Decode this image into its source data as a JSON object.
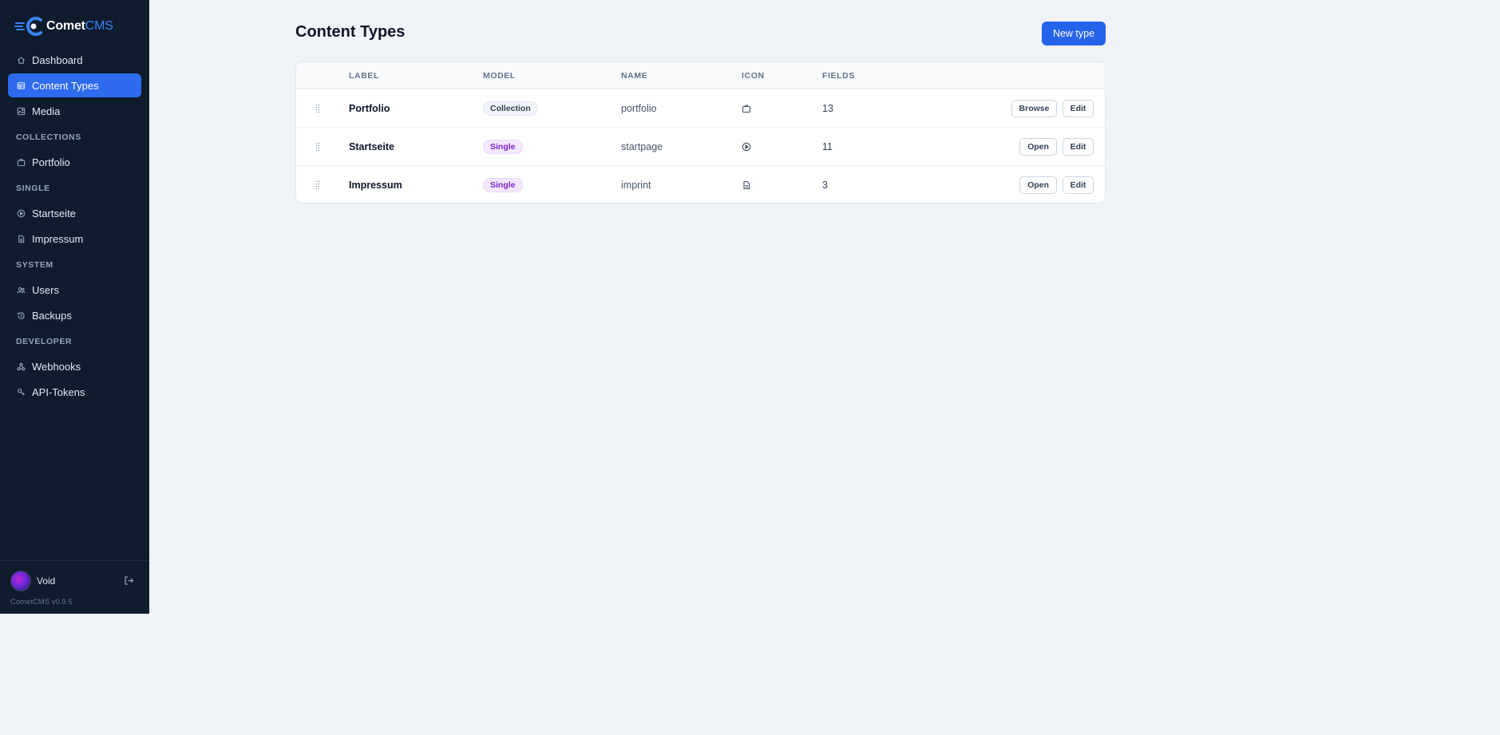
{
  "app": {
    "name_main": "Comet",
    "name_accent": "CMS",
    "version": "CometCMS v0.9.5"
  },
  "sidebar": {
    "items_top": [
      {
        "label": "Dashboard",
        "icon": "home-icon"
      },
      {
        "label": "Content Types",
        "icon": "table-icon",
        "active": true
      },
      {
        "label": "Media",
        "icon": "image-icon"
      }
    ],
    "section_collections": "COLLECTIONS",
    "items_collections": [
      {
        "label": "Portfolio",
        "icon": "briefcase-icon"
      }
    ],
    "section_single": "SINGLE",
    "items_single": [
      {
        "label": "Startseite",
        "icon": "play-circle-icon"
      },
      {
        "label": "Impressum",
        "icon": "document-icon"
      }
    ],
    "section_system": "SYSTEM",
    "items_system": [
      {
        "label": "Users",
        "icon": "users-icon"
      },
      {
        "label": "Backups",
        "icon": "history-icon"
      }
    ],
    "section_developer": "DEVELOPER",
    "items_developer": [
      {
        "label": "Webhooks",
        "icon": "webhook-icon"
      },
      {
        "label": "API-Tokens",
        "icon": "key-icon"
      }
    ],
    "user": {
      "name": "Void"
    }
  },
  "main": {
    "title": "Content Types",
    "new_button": "New type",
    "columns": {
      "label": "LABEL",
      "model": "MODEL",
      "name": "NAME",
      "icon": "ICON",
      "fields": "FIELDS"
    },
    "rows": [
      {
        "label": "Portfolio",
        "model": "Collection",
        "name": "portfolio",
        "icon": "briefcase-icon",
        "fields": "13",
        "action": "Browse",
        "edit": "Edit"
      },
      {
        "label": "Startseite",
        "model": "Single",
        "name": "startpage",
        "icon": "play-circle-icon",
        "fields": "11",
        "action": "Open",
        "edit": "Edit"
      },
      {
        "label": "Impressum",
        "model": "Single",
        "name": "imprint",
        "icon": "document-icon",
        "fields": "3",
        "action": "Open",
        "edit": "Edit"
      }
    ]
  },
  "colors": {
    "sidebar_bg": "#0f1c2e",
    "accent": "#2563eb",
    "active_nav": "#2f6bef",
    "page_bg": "#f0f4f9",
    "single_badge": "#7e22ce"
  }
}
